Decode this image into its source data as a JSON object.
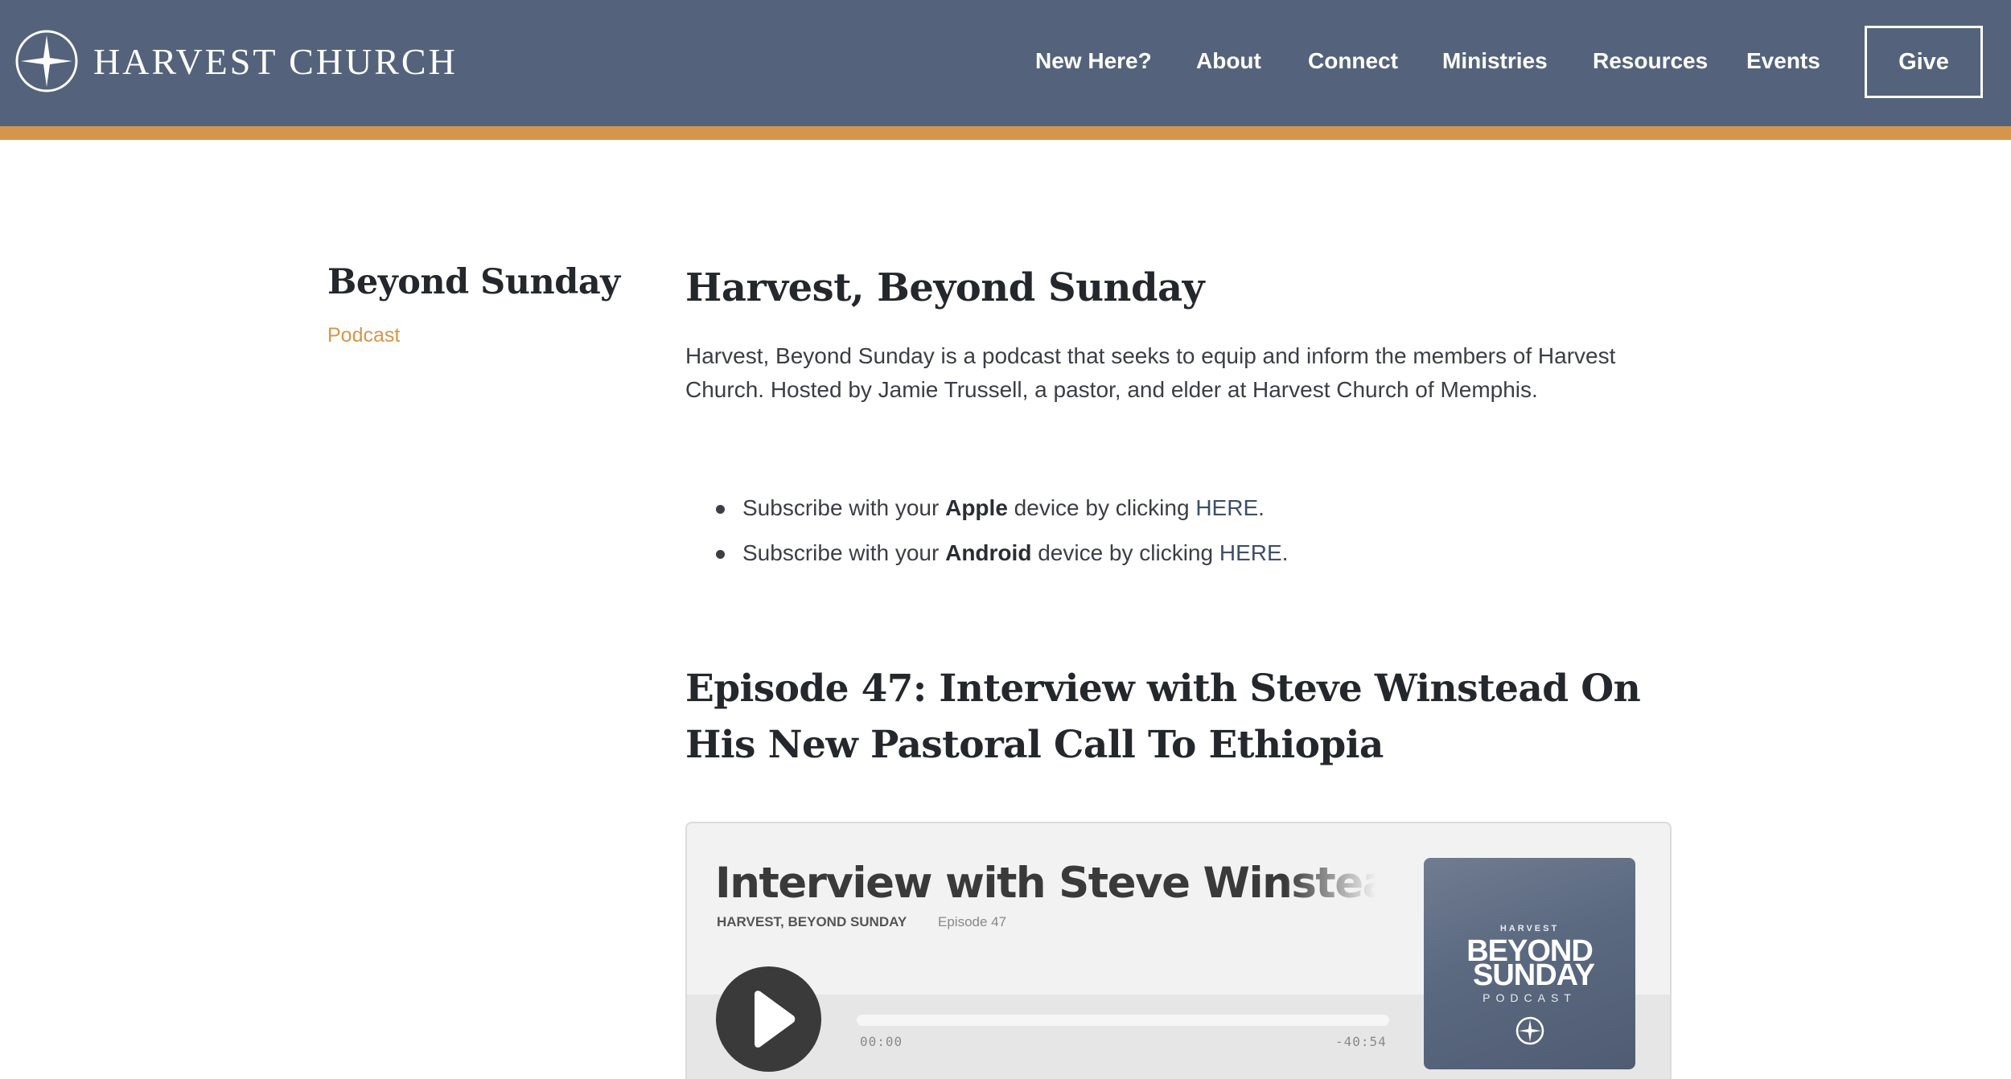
{
  "header": {
    "site_name": "HARVEST CHURCH",
    "nav": [
      {
        "label": "New Here?"
      },
      {
        "label": "About"
      },
      {
        "label": "Connect"
      },
      {
        "label": "Ministries"
      },
      {
        "label": "Resources"
      },
      {
        "label": "Events"
      }
    ],
    "give_label": "Give",
    "colors": {
      "bar": "#54637b",
      "stripe": "#d4964a"
    }
  },
  "sidebar": {
    "title": "Beyond Sunday",
    "subtitle": "Podcast"
  },
  "main": {
    "title": "Harvest, Beyond Sunday",
    "description": "Harvest, Beyond Sunday is a podcast that seeks to equip and inform the members of Harvest Church. Hosted by Jamie Trussell, a pastor, and elder at Harvest Church of Memphis.",
    "subscribe": [
      {
        "prefix": "Subscribe with your ",
        "device": "Apple",
        "middle": " device by clicking ",
        "link": "HERE",
        "suffix": "."
      },
      {
        "prefix": "Subscribe with your ",
        "device": "Android",
        "middle": " device by clicking ",
        "link": "HERE",
        "suffix": "."
      }
    ],
    "episode_title": "Episode 47: Interview with Steve Winstead On His New Pastoral Call To Ethiopia"
  },
  "player": {
    "title": "Interview with Steve Winstead On His New Pastoral Call To Ethiopia",
    "show": "HARVEST, BEYOND SUNDAY",
    "episode": "Episode 47",
    "time_elapsed": "00:00",
    "time_remaining": "-40:54",
    "progress": 0,
    "play_icon": "play-icon",
    "cover": {
      "small": "HARVEST",
      "line1": "BEYOND",
      "line2": "SUNDAY",
      "podcast": "PODCAST"
    }
  }
}
